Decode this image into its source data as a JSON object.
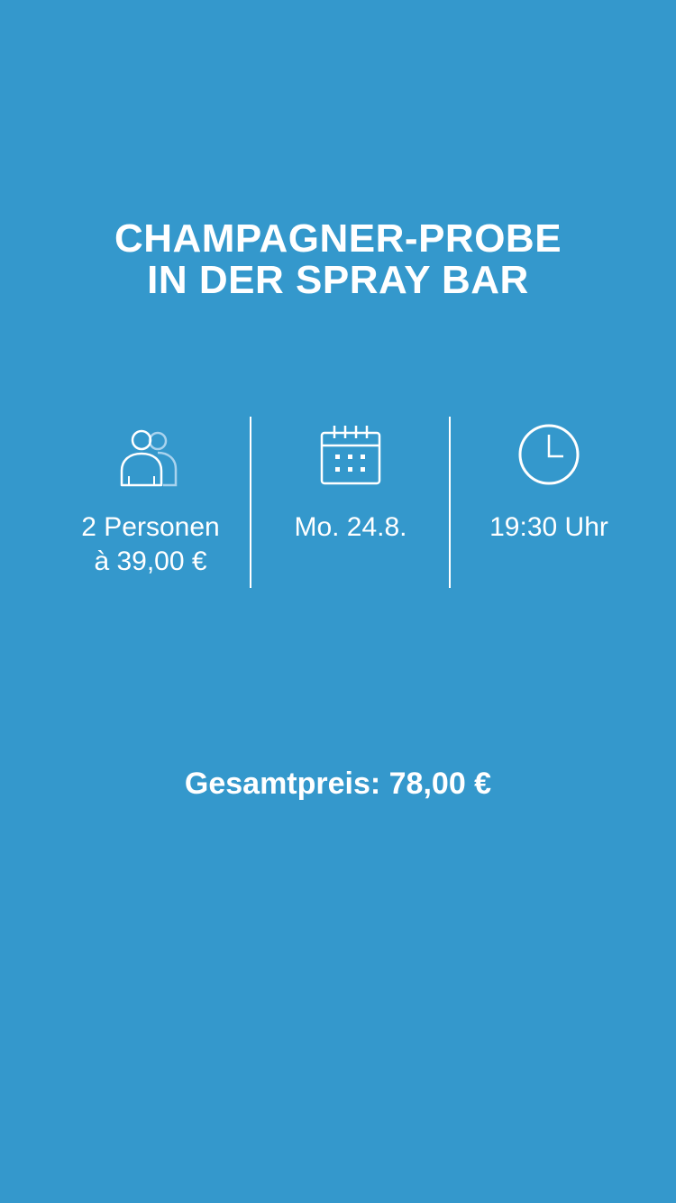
{
  "title": {
    "line1": "CHAMPAGNER-PROBE",
    "line2": "IN DER SPRAY BAR"
  },
  "details": {
    "persons": {
      "icon": "persons-icon",
      "line1": "2 Personen",
      "line2": "à 39,00 €"
    },
    "date": {
      "icon": "calendar-icon",
      "label": "Mo. 24.8."
    },
    "time": {
      "icon": "clock-icon",
      "label": "19:30 Uhr"
    }
  },
  "total": {
    "label": "Gesamtpreis: 78,00 €"
  },
  "colors": {
    "background": "#3498cc",
    "text": "#ffffff",
    "secondary_icon": "#a9d3ee"
  }
}
